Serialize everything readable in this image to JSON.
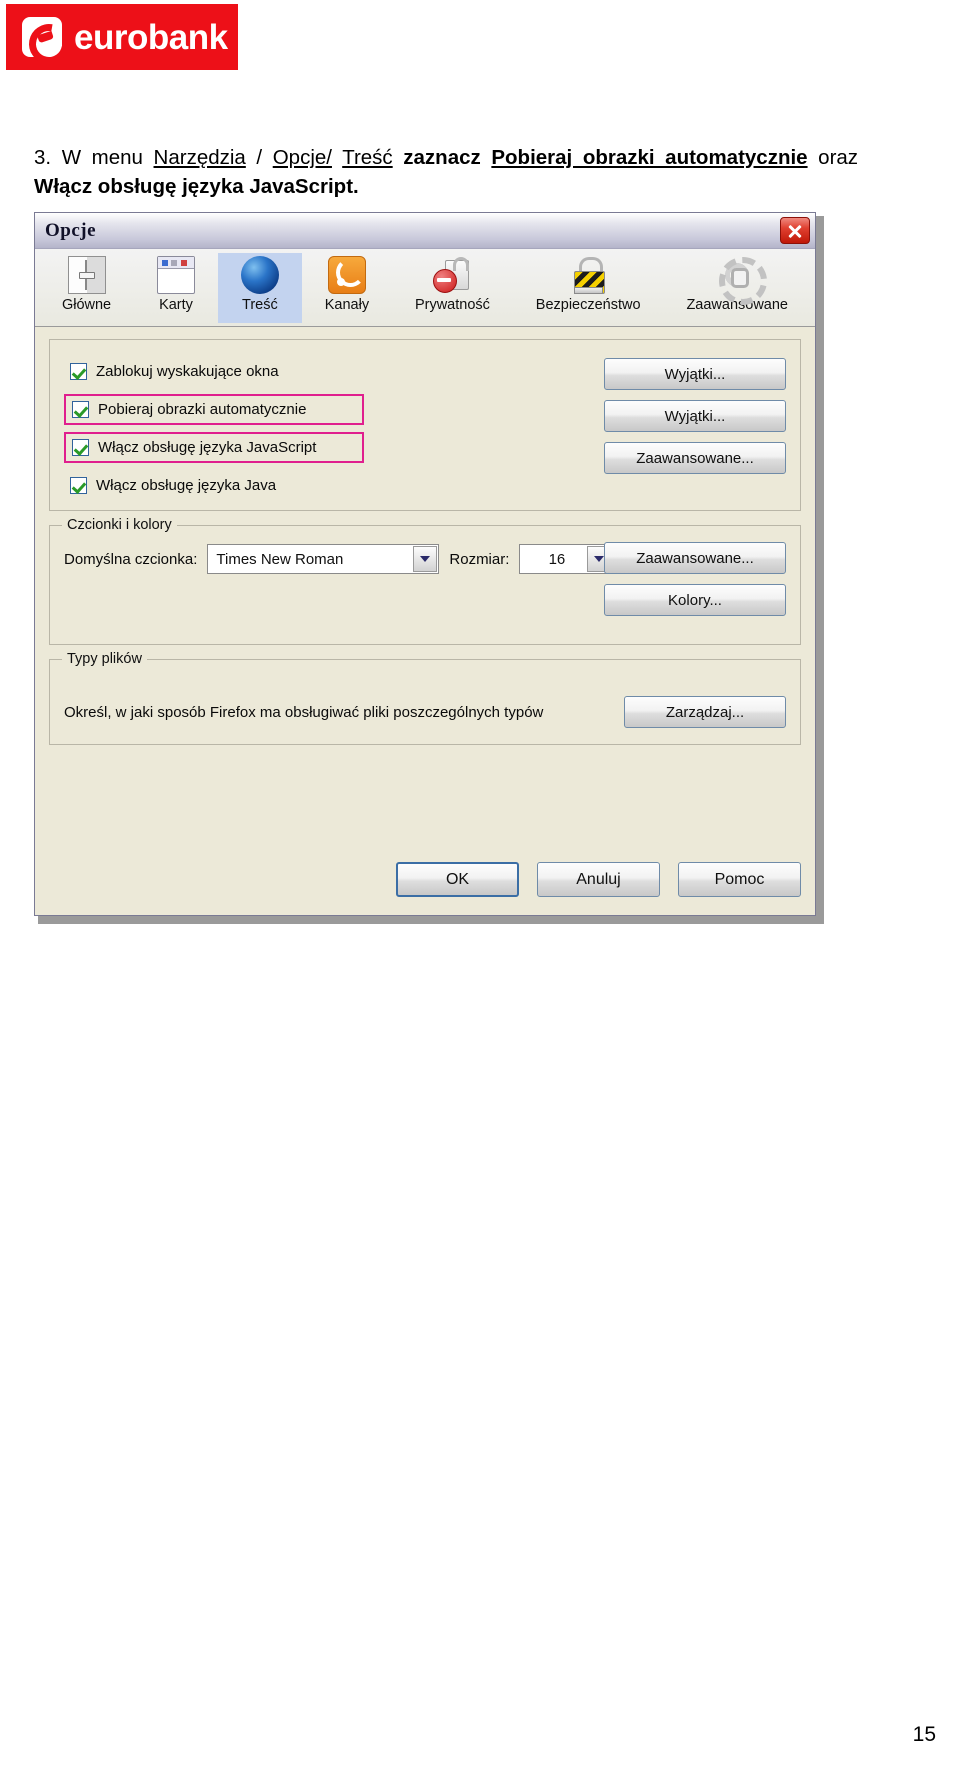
{
  "brand": {
    "name": "eurobank",
    "logo_icon": "eurobank-e-mark-icon",
    "bar_color": "#ed1018"
  },
  "instruction": {
    "number": "3.",
    "seg_w": "W",
    "seg_menu": "menu",
    "seg_narzedzia": "Narzędzia",
    "seg_slash1": "/",
    "seg_opcje": "Opcje/",
    "seg_tresc": "Treść",
    "seg_zaznacz": "zaznacz",
    "seg_pobieraj": "Pobieraj obrazki automatycznie",
    "seg_oraz": "oraz",
    "seg_wlacz": "Włącz obsługę języka JavaScript",
    "seg_dot": "."
  },
  "dialog": {
    "title": "Opcje",
    "close_icon": "close-x-icon",
    "tabs": [
      {
        "label": "Główne",
        "icon": "sliders-icon",
        "selected": false
      },
      {
        "label": "Karty",
        "icon": "tabs-icon",
        "selected": false
      },
      {
        "label": "Treść",
        "icon": "globe-icon",
        "selected": true
      },
      {
        "label": "Kanały",
        "icon": "rss-feed-icon",
        "selected": false
      },
      {
        "label": "Prywatność",
        "icon": "no-entry-folder-icon",
        "selected": false
      },
      {
        "label": "Bezpieczeństwo",
        "icon": "padlock-icon",
        "selected": false
      },
      {
        "label": "Zaawansowane",
        "icon": "gear-icon",
        "selected": false
      }
    ],
    "checkboxes": [
      {
        "label": "Zablokuj wyskakujące okna",
        "checked": true,
        "highlighted": false,
        "accel": "b"
      },
      {
        "label": "Pobieraj obrazki automatycznie",
        "checked": true,
        "highlighted": true,
        "accel": "o"
      },
      {
        "label": "Włącz obsługę języka JavaScript",
        "checked": true,
        "highlighted": true,
        "accel": "J"
      },
      {
        "label": "Włącz obsługę języka Java",
        "checked": true,
        "highlighted": false,
        "accel": "v"
      }
    ],
    "check_buttons": [
      {
        "label": "Wyjątki..."
      },
      {
        "label": "Wyjątki..."
      },
      {
        "label": "Zaawansowane..."
      }
    ],
    "fonts_group": {
      "legend": "Czcionki i kolory",
      "font_label": "Domyślna czcionka:",
      "font_value": "Times New Roman",
      "size_label": "Rozmiar:",
      "size_value": "16",
      "advanced_button": "Zaawansowane...",
      "colors_button": "Kolory..."
    },
    "types_group": {
      "legend": "Typy plików",
      "description": "Określ, w jaki sposób Firefox ma obsługiwać pliki poszczególnych typów",
      "manage_button": "Zarządzaj..."
    },
    "bottom_buttons": {
      "ok": "OK",
      "cancel": "Anuluj",
      "help": "Pomoc"
    },
    "highlight_color": "#e01f8e"
  },
  "page_number": "15"
}
